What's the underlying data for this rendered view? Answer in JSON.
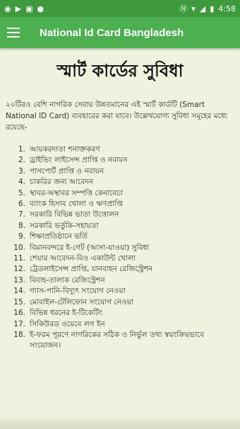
{
  "status_bar": {
    "time": "4:58",
    "left_icons": [
      "whatsapp-icon",
      "video-icon",
      "image-icon",
      "notification-icon"
    ],
    "right_icons": [
      "nfc-icon",
      "wifi-icon",
      "signal-icon",
      "battery-icon"
    ]
  },
  "app_bar": {
    "title": "National Id Card Bangladesh"
  },
  "page": {
    "heading": "স্মার্ট কার্ডের সুবিধা",
    "intro": "২০টিরও বেশি নাগরিক সেবায় উন্নতমানের এই স্মার্ট কার্ডটি (Smart National ID Card) ব্যবহারের করা যাবে। উল্লেখযোগ্য সুবিধা সমূহের মধ্যে রয়েছে-",
    "benefits": [
      {
        "num": "1.",
        "text": "আয়করদাতা শনাক্তকরণ"
      },
      {
        "num": "2.",
        "text": "ড্রাইভিং লাইসেন্স প্রাপ্তি ও নবায়ন"
      },
      {
        "num": "3.",
        "text": "পাসপোর্ট প্রাপ্তি ও নবায়ন"
      },
      {
        "num": "4.",
        "text": "চাকরির জন্য আবেদন"
      },
      {
        "num": "5.",
        "text": "স্থাবর-অস্থাবর সম্পত্তি কেনাবেচা"
      },
      {
        "num": "6.",
        "text": "ব্যাংক হিসাব খোলা ও ঋণপ্রাপ্তি"
      },
      {
        "num": "7.",
        "text": "সরকারি বিভিন্ন ভাতা উত্তোলন"
      },
      {
        "num": "8.",
        "text": "সরকারি ভর্তুকি-সহায়তা"
      },
      {
        "num": "9.",
        "text": "শিক্ষাপ্রতিষ্ঠানে ভর্তি"
      },
      {
        "num": "10.",
        "text": "বিমানবন্দরে ই-গেট (আসা-যাওয়া) সুবিধা"
      },
      {
        "num": "11.",
        "text": "শেয়ার আবেদন-বিও একাউন্ট খোলা"
      },
      {
        "num": "12.",
        "text": "ট্রেডলাইসেন্স প্রাপ্তি, যানবাহন রেজিস্ট্রেশন"
      },
      {
        "num": "13.",
        "text": "বিবাহ-তালাক রেজিস্ট্রেশন"
      },
      {
        "num": "14.",
        "text": "গ্যাস-পানি-বিদ্যুৎ সংযোগ নেওয়া"
      },
      {
        "num": "15.",
        "text": "মোবাইল-টেলিফোন সংযোগ নেওয়া"
      },
      {
        "num": "16.",
        "text": "বিভিন্ন ধরনের ই-টিকেটিং"
      },
      {
        "num": "17.",
        "text": "সিকিউরড ওয়েবে লগ ইন"
      },
      {
        "num": "18.",
        "text": "ই-ফরম পূরণে নাগরিকের সঠিক ও নির্ভুল তথ্য স্বয়ংক্রিয়ভাবে সংযোজন।"
      }
    ]
  },
  "colors": {
    "status_bar": "#3f9a3d",
    "app_bar": "#4caf50",
    "background": "#eef2df"
  }
}
